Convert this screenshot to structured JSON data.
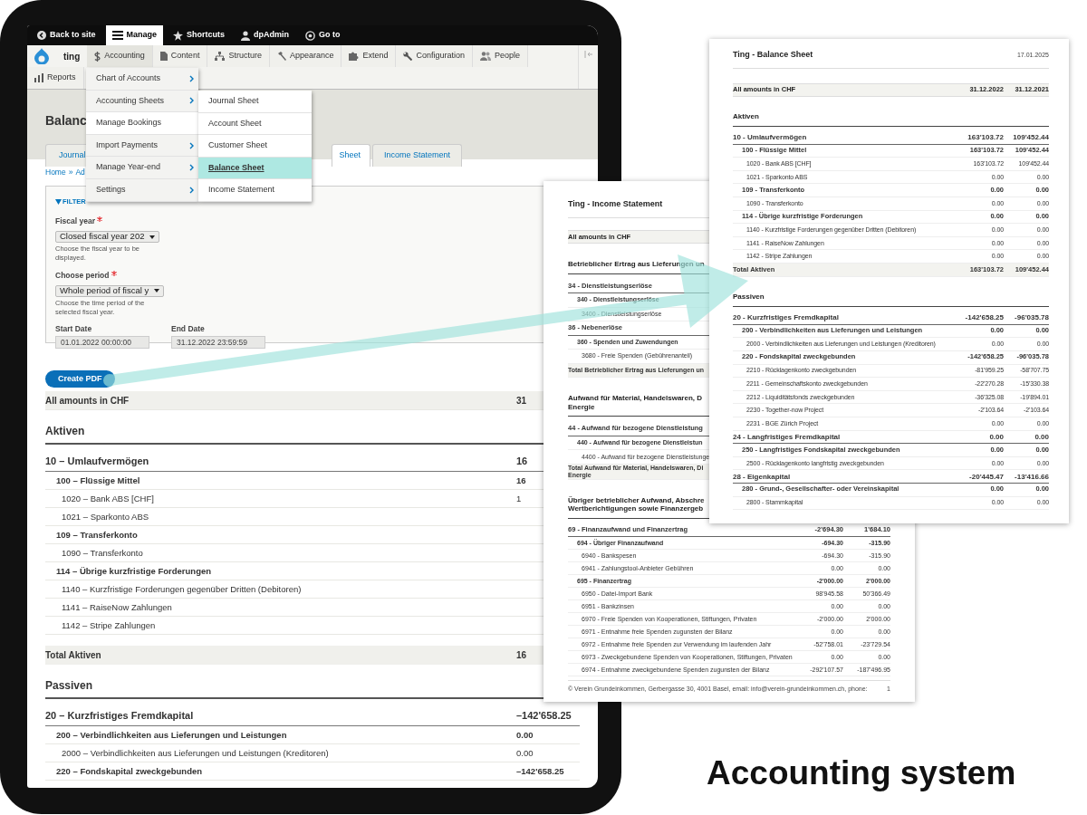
{
  "tablet": {
    "toolbar": [
      {
        "label": "Back to site",
        "selected": false
      },
      {
        "label": "Manage",
        "selected": true
      },
      {
        "label": "Shortcuts",
        "selected": false
      },
      {
        "label": "dpAdmin",
        "selected": false
      },
      {
        "label": "Go to",
        "selected": false
      }
    ],
    "site_name": "ting",
    "admin_menu": [
      {
        "label": "Accounting",
        "selected": true
      },
      {
        "label": "Content",
        "selected": false
      },
      {
        "label": "Structure",
        "selected": false
      },
      {
        "label": "Appearance",
        "selected": false
      },
      {
        "label": "Extend",
        "selected": false
      },
      {
        "label": "Configuration",
        "selected": false
      },
      {
        "label": "People",
        "selected": false
      },
      {
        "label": "Reports",
        "selected": false
      }
    ],
    "dropdown": [
      {
        "label": "Chart of Accounts",
        "has_submenu": true
      },
      {
        "label": "Accounting Sheets",
        "has_submenu": true
      },
      {
        "label": "Manage Bookings",
        "has_submenu": false
      },
      {
        "label": "Import Payments",
        "has_submenu": true
      },
      {
        "label": "Manage Year-end",
        "has_submenu": true
      },
      {
        "label": "Settings",
        "has_submenu": true
      }
    ],
    "submenu": [
      {
        "label": "Journal Sheet",
        "selected": false
      },
      {
        "label": "Account Sheet",
        "selected": false
      },
      {
        "label": "Customer Sheet",
        "selected": false
      },
      {
        "label": "Balance Sheet",
        "selected": true
      },
      {
        "label": "Income Statement",
        "selected": false
      }
    ],
    "page_title": "Balanc",
    "tabs": [
      {
        "label": "Journal",
        "selected": false
      },
      {
        "label": "Sheet",
        "selected": true
      },
      {
        "label": "Income Statement",
        "selected": false
      }
    ],
    "breadcrumb": {
      "items": [
        "Home",
        "Ad"
      ],
      "separator": "»"
    },
    "filter": {
      "legend": "FILTER",
      "expanded": true,
      "selects": [
        {
          "label": "Fiscal year",
          "required": true,
          "value": "Closed fiscal year 202",
          "description": "Choose the fiscal year to be displayed."
        },
        {
          "label": "Choose period",
          "required": true,
          "value": "Whole period of fiscal y",
          "description": "Choose the time period of the selected fiscal year."
        }
      ],
      "dates": [
        {
          "label": "Start Date",
          "value": "01.01.2022 00:00:00"
        },
        {
          "label": "End Date",
          "value": "31.12.2022 23:59:59"
        }
      ]
    },
    "button": "Create PDF",
    "sheet": {
      "header": {
        "label": "All amounts in CHF",
        "values": [
          "31"
        ]
      },
      "sections": [
        {
          "title": "Aktiven",
          "rows": [
            {
              "label": "10 – Umlaufvermögen",
              "values": [
                "16"
              ],
              "children": [
                {
                  "label": "100 – Flüssige Mittel",
                  "values": [
                    "16"
                  ],
                  "children": [
                    {
                      "label": "1020 – Bank ABS [CHF]",
                      "values": [
                        "1"
                      ]
                    },
                    {
                      "label": "1021 – Sparkonto ABS"
                    }
                  ]
                },
                {
                  "label": "109 – Transferkonto",
                  "children": [
                    {
                      "label": "1090 – Transferkonto"
                    }
                  ]
                },
                {
                  "label": "114 – Übrige kurzfristige Forderungen",
                  "children": [
                    {
                      "label": "1140 – Kurzfristige Forderungen gegenüber Dritten (Debitoren)"
                    },
                    {
                      "label": "1141 – RaiseNow Zahlungen"
                    },
                    {
                      "label": "1142 – Stripe Zahlungen"
                    }
                  ]
                }
              ]
            }
          ],
          "total": {
            "label": "Total Aktiven",
            "values": [
              "16"
            ]
          }
        },
        {
          "title": "Passiven",
          "rows": [
            {
              "label": "20 – Kurzfristiges Fremdkapital",
              "values": [
                "–142'658.25"
              ],
              "children": [
                {
                  "label": "200 – Verbindlichkeiten aus Lieferungen und Leistungen",
                  "values": [
                    "0.00"
                  ],
                  "children": [
                    {
                      "label": "2000 – Verbindlichkeiten aus Lieferungen und Leistungen (Kreditoren)",
                      "values": [
                        "0.00"
                      ]
                    }
                  ]
                },
                {
                  "label": "220 – Fondskapital zweckgebunden",
                  "values": [
                    "–142'658.25"
                  ]
                }
              ]
            }
          ]
        }
      ]
    }
  },
  "income_statement": {
    "title": "Ting - Income Statement",
    "header": {
      "label": "All amounts in CHF"
    },
    "sections": [
      {
        "title": "Betrieblicher Ertrag aus Lieferungen un",
        "rows": [
          {
            "label": "34 - Dienstleistungserlöse",
            "children": [
              {
                "label": "340 - Dienstleistungserlöse",
                "children": [
                  {
                    "label": "3400 - Dienstleistungserlöse"
                  }
                ]
              }
            ]
          },
          {
            "label": "36 - Nebenerlöse",
            "children": [
              {
                "label": "360 - Spenden und Zuwendungen",
                "children": [
                  {
                    "label": "3680 - Freie Spenden (Gebührenanteil)"
                  }
                ]
              }
            ]
          }
        ],
        "total": {
          "label": "Total Betrieblicher Ertrag aus Lieferungen un"
        }
      },
      {
        "title": "Aufwand für Material, Handelswaren, D\nEnergie",
        "rows": [
          {
            "label": "44 - Aufwand für bezogene Dienstleistung",
            "children": [
              {
                "label": "440 - Aufwand für bezogene Dienstleistun",
                "children": [
                  {
                    "label": "4400 - Aufwand für bezogene Dienstleistunge"
                  }
                ]
              }
            ]
          }
        ],
        "total": {
          "label": "Total Aufwand für Material, Handelswaren, Di\nEnergie"
        }
      },
      {
        "title": "Übriger betrieblicher Aufwand, Abschre\nWertberichtigungen sowie Finanzergeb",
        "rows": [
          {
            "label": "69 - Finanzaufwand und Finanzertrag",
            "values": [
              "-2'694.30",
              "1'684.10"
            ],
            "children": [
              {
                "label": "694 - Übriger Finanzaufwand",
                "values": [
                  "-694.30",
                  "-315.90"
                ],
                "children": [
                  {
                    "label": "6940 - Bankspesen",
                    "values": [
                      "-694.30",
                      "-315.90"
                    ]
                  },
                  {
                    "label": "6941 - Zahlungstool-Anbieter Gebühren",
                    "values": [
                      "0.00",
                      "0.00"
                    ]
                  }
                ]
              },
              {
                "label": "695 - Finanzertrag",
                "values": [
                  "-2'000.00",
                  "2'000.00"
                ],
                "children": [
                  {
                    "label": "6950 - Datei-Import Bank",
                    "values": [
                      "98'945.58",
                      "50'366.49"
                    ]
                  },
                  {
                    "label": "6951 - Bankzinsen",
                    "values": [
                      "0.00",
                      "0.00"
                    ]
                  },
                  {
                    "label": "6970 - Freie Spenden von Kooperationen, Stiftungen, Privaten",
                    "values": [
                      "-2'000.00",
                      "2'000.00"
                    ]
                  },
                  {
                    "label": "6971 - Entnahme freie Spenden zugunsten der Bilanz",
                    "values": [
                      "0.00",
                      "0.00"
                    ]
                  },
                  {
                    "label": "6972 - Entnahme freie Spenden zur Verwendung im laufenden Jahr",
                    "values": [
                      "-52'758.01",
                      "-23'729.54"
                    ]
                  },
                  {
                    "label": "6973 - Zweckgebundene Spenden von Kooperationen, Stiftungen, Privaten",
                    "values": [
                      "0.00",
                      "0.00"
                    ]
                  },
                  {
                    "label": "6974 - Entnahme zweckgebundene Spenden zugunsten der Bilanz",
                    "values": [
                      "-292'107.57",
                      "-187'496.95"
                    ]
                  }
                ]
              }
            ]
          }
        ]
      }
    ],
    "footer": "© Verein Grundeinkommen, Gerbergasse 30, 4001 Basel, email: info@verein-grundeinkommen.ch, phone:",
    "page_number": "1"
  },
  "balance_sheet": {
    "title": "Ting - Balance Sheet",
    "date": "17.01.2025",
    "header": {
      "label": "All amounts in CHF",
      "values": [
        "31.12.2022",
        "31.12.2021"
      ]
    },
    "sections": [
      {
        "title": "Aktiven",
        "rows": [
          {
            "label": "10 - Umlaufvermögen",
            "values": [
              "163'103.72",
              "109'452.44"
            ],
            "children": [
              {
                "label": "100 - Flüssige Mittel",
                "values": [
                  "163'103.72",
                  "109'452.44"
                ],
                "children": [
                  {
                    "label": "1020 - Bank ABS [CHF]",
                    "values": [
                      "163'103.72",
                      "109'452.44"
                    ]
                  },
                  {
                    "label": "1021 - Sparkonto ABS",
                    "values": [
                      "0.00",
                      "0.00"
                    ]
                  }
                ]
              },
              {
                "label": "109 - Transferkonto",
                "values": [
                  "0.00",
                  "0.00"
                ],
                "children": [
                  {
                    "label": "1090 - Transferkonto",
                    "values": [
                      "0.00",
                      "0.00"
                    ]
                  }
                ]
              },
              {
                "label": "114 - Übrige kurzfristige Forderungen",
                "values": [
                  "0.00",
                  "0.00"
                ],
                "children": [
                  {
                    "label": "1140 - Kurzfristige Forderungen gegenüber Dritten (Debitoren)",
                    "values": [
                      "0.00",
                      "0.00"
                    ]
                  },
                  {
                    "label": "1141 - RaiseNow Zahlungen",
                    "values": [
                      "0.00",
                      "0.00"
                    ]
                  },
                  {
                    "label": "1142 - Stripe Zahlungen",
                    "values": [
                      "0.00",
                      "0.00"
                    ]
                  }
                ]
              }
            ]
          }
        ],
        "total": {
          "label": "Total Aktiven",
          "values": [
            "163'103.72",
            "109'452.44"
          ]
        }
      },
      {
        "title": "Passiven",
        "rows": [
          {
            "label": "20 - Kurzfristiges Fremdkapital",
            "values": [
              "-142'658.25",
              "-96'035.78"
            ],
            "children": [
              {
                "label": "200 - Verbindlichkeiten aus Lieferungen und Leistungen",
                "values": [
                  "0.00",
                  "0.00"
                ],
                "children": [
                  {
                    "label": "2000 - Verbindlichkeiten aus Lieferungen und Leistungen (Kreditoren)",
                    "values": [
                      "0.00",
                      "0.00"
                    ]
                  }
                ]
              },
              {
                "label": "220 - Fondskapital zweckgebunden",
                "values": [
                  "-142'658.25",
                  "-96'035.78"
                ],
                "children": [
                  {
                    "label": "2210 - Rücklagenkonto zweckgebunden",
                    "values": [
                      "-81'959.25",
                      "-58'707.75"
                    ]
                  },
                  {
                    "label": "2211 - Gemeinschaftskonto zweckgebunden",
                    "values": [
                      "-22'270.28",
                      "-15'330.38"
                    ]
                  },
                  {
                    "label": "2212 - Liquiditätsfonds zweckgebunden",
                    "values": [
                      "-36'325.08",
                      "-19'894.01"
                    ]
                  },
                  {
                    "label": "2230 - Together-now Project",
                    "values": [
                      "-2'103.64",
                      "-2'103.64"
                    ]
                  },
                  {
                    "label": "2231 - BGE Zürich Project",
                    "values": [
                      "0.00",
                      "0.00"
                    ]
                  }
                ]
              }
            ]
          },
          {
            "label": "24 - Langfristiges Fremdkapital",
            "values": [
              "0.00",
              "0.00"
            ],
            "children": [
              {
                "label": "250 - Langfristiges Fondskapital zweckgebunden",
                "values": [
                  "0.00",
                  "0.00"
                ],
                "children": [
                  {
                    "label": "2500 - Rücklagenkonto langfristig zweckgebunden",
                    "values": [
                      "0.00",
                      "0.00"
                    ]
                  }
                ]
              }
            ]
          },
          {
            "label": "28 - Eigenkapital",
            "values": [
              "-20'445.47",
              "-13'416.66"
            ],
            "children": [
              {
                "label": "280 - Grund-, Gesellschafter- oder Vereinskapital",
                "values": [
                  "0.00",
                  "0.00"
                ],
                "children": [
                  {
                    "label": "2800 - Stammkapital",
                    "values": [
                      "0.00",
                      "0.00"
                    ]
                  }
                ]
              }
            ]
          }
        ]
      }
    ]
  },
  "caption": "Accounting system"
}
